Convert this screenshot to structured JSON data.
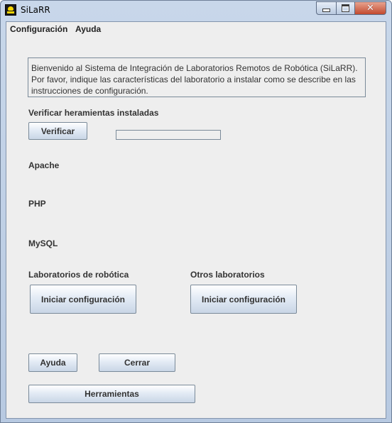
{
  "window": {
    "title": "SiLaRR",
    "close_glyph": "✕",
    "icons": [
      "app-icon",
      "minimize-icon",
      "maximize-icon",
      "close-icon"
    ]
  },
  "menu": {
    "items": [
      "Configuración",
      "Ayuda"
    ]
  },
  "welcome_text": "Bienvenido al Sistema de Integración de Laboratorios Remotos de Robótica (SiLaRR). Por favor, indique las características del laboratorio a instalar como se describe en las instrucciones de configuración.",
  "verify": {
    "heading": "Verificar heramientas instaladas",
    "button_label": "Verificar",
    "progress": 0
  },
  "tools": {
    "apache": "Apache",
    "php": "PHP",
    "mysql": "MySQL"
  },
  "robotics_labs": {
    "heading": "Laboratorios de robótica",
    "button_label": "Iniciar configuración"
  },
  "other_labs": {
    "heading": "Otros laboratorios",
    "button_label": "Iniciar configuración"
  },
  "footer": {
    "help_label": "Ayuda",
    "close_label": "Cerrar",
    "tools_label": "Herramientas"
  }
}
